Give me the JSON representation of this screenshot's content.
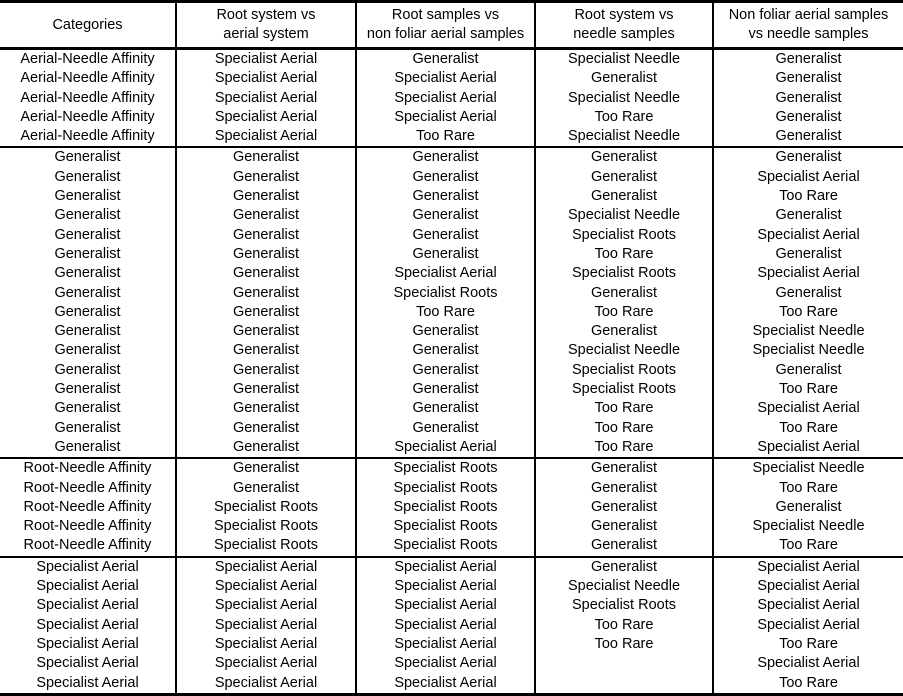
{
  "table": {
    "columns": [
      {
        "id": "categories",
        "label_lines": [
          "Categories"
        ]
      },
      {
        "id": "root_vs_aerial",
        "label_lines": [
          "Root system vs",
          "aerial system"
        ]
      },
      {
        "id": "rootsamples_vs_nonfoliar",
        "label_lines": [
          "Root samples vs",
          "non foliar aerial samples"
        ]
      },
      {
        "id": "rootsystem_vs_needle",
        "label_lines": [
          "Root system vs",
          "needle samples"
        ]
      },
      {
        "id": "nonfoliar_vs_needle",
        "label_lines": [
          "Non foliar aerial samples",
          "vs needle samples"
        ]
      }
    ],
    "blocks": [
      {
        "name": "aerial-needle-affinity",
        "rows": [
          [
            "Aerial-Needle Affinity",
            "Specialist Aerial",
            "Generalist",
            "Specialist Needle",
            "Generalist"
          ],
          [
            "Aerial-Needle Affinity",
            "Specialist Aerial",
            "Specialist Aerial",
            "Generalist",
            "Generalist"
          ],
          [
            "Aerial-Needle Affinity",
            "Specialist Aerial",
            "Specialist Aerial",
            "Specialist Needle",
            "Generalist"
          ],
          [
            "Aerial-Needle Affinity",
            "Specialist Aerial",
            "Specialist Aerial",
            "Too Rare",
            "Generalist"
          ],
          [
            "Aerial-Needle Affinity",
            "Specialist Aerial",
            "Too Rare",
            "Specialist Needle",
            "Generalist"
          ]
        ]
      },
      {
        "name": "generalist",
        "rows": [
          [
            "Generalist",
            "Generalist",
            "Generalist",
            "Generalist",
            "Generalist"
          ],
          [
            "Generalist",
            "Generalist",
            "Generalist",
            "Generalist",
            "Specialist Aerial"
          ],
          [
            "Generalist",
            "Generalist",
            "Generalist",
            "Generalist",
            "Too Rare"
          ],
          [
            "Generalist",
            "Generalist",
            "Generalist",
            "Specialist Needle",
            "Generalist"
          ],
          [
            "Generalist",
            "Generalist",
            "Generalist",
            "Specialist Roots",
            "Specialist Aerial"
          ],
          [
            "Generalist",
            "Generalist",
            "Generalist",
            "Too Rare",
            "Generalist"
          ],
          [
            "Generalist",
            "Generalist",
            "Specialist Aerial",
            "Specialist Roots",
            "Specialist Aerial"
          ],
          [
            "Generalist",
            "Generalist",
            "Specialist Roots",
            "Generalist",
            "Generalist"
          ],
          [
            "Generalist",
            "Generalist",
            "Too Rare",
            "Too Rare",
            "Too Rare"
          ],
          [
            "Generalist",
            "Generalist",
            "Generalist",
            "Generalist",
            "Specialist Needle"
          ],
          [
            "Generalist",
            "Generalist",
            "Generalist",
            "Specialist Needle",
            "Specialist Needle"
          ],
          [
            "Generalist",
            "Generalist",
            "Generalist",
            "Specialist Roots",
            "Generalist"
          ],
          [
            "Generalist",
            "Generalist",
            "Generalist",
            "Specialist Roots",
            "Too Rare"
          ],
          [
            "Generalist",
            "Generalist",
            "Generalist",
            "Too Rare",
            "Specialist Aerial"
          ],
          [
            "Generalist",
            "Generalist",
            "Generalist",
            "Too Rare",
            "Too Rare"
          ],
          [
            "Generalist",
            "Generalist",
            "Specialist Aerial",
            "Too Rare",
            "Specialist Aerial"
          ]
        ]
      },
      {
        "name": "root-needle-affinity",
        "rows": [
          [
            "Root-Needle Affinity",
            "Generalist",
            "Specialist Roots",
            "Generalist",
            "Specialist Needle"
          ],
          [
            "Root-Needle Affinity",
            "Generalist",
            "Specialist Roots",
            "Generalist",
            "Too Rare"
          ],
          [
            "Root-Needle Affinity",
            "Specialist Roots",
            "Specialist Roots",
            "Generalist",
            "Generalist"
          ],
          [
            "Root-Needle Affinity",
            "Specialist Roots",
            "Specialist Roots",
            "Generalist",
            "Specialist Needle"
          ],
          [
            "Root-Needle Affinity",
            "Specialist Roots",
            "Specialist Roots",
            "Generalist",
            "Too Rare"
          ]
        ]
      },
      {
        "name": "specialist-aerial",
        "rows": [
          [
            "Specialist Aerial",
            "Specialist Aerial",
            "Specialist Aerial",
            "Generalist",
            "Specialist Aerial"
          ],
          [
            "Specialist Aerial",
            "Specialist Aerial",
            "Specialist Aerial",
            "Specialist Needle",
            "Specialist Aerial"
          ],
          [
            "Specialist Aerial",
            "Specialist Aerial",
            "Specialist Aerial",
            "Specialist Roots",
            "Specialist Aerial"
          ],
          [
            "Specialist Aerial",
            "Specialist Aerial",
            "Specialist Aerial",
            "Too Rare",
            "Specialist Aerial"
          ],
          [
            "Specialist Aerial",
            "Specialist Aerial",
            "Specialist Aerial",
            "Too Rare",
            "Too Rare"
          ],
          [
            "Specialist Aerial",
            "Specialist Aerial",
            "Specialist Aerial",
            "",
            "Specialist Aerial"
          ],
          [
            "Specialist Aerial",
            "Specialist Aerial",
            "Specialist Aerial",
            "",
            "Too Rare"
          ]
        ]
      }
    ]
  },
  "style": {
    "text_color": "#000000",
    "background_color": "#ffffff",
    "rule_color": "#000000"
  }
}
